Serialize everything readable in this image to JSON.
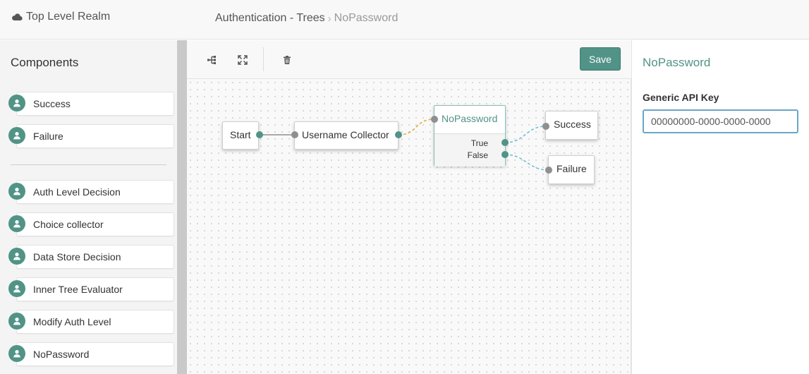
{
  "header": {
    "realm_icon": "cloud-icon",
    "realm": "Top Level Realm",
    "breadcrumb": {
      "parent": "Authentication - Trees",
      "separator": "›",
      "current": "NoPassword"
    }
  },
  "sidebar": {
    "title": "Components",
    "item_icon": "user-icon",
    "top_items": [
      {
        "label": "Success"
      },
      {
        "label": "Failure"
      }
    ],
    "items": [
      {
        "label": "Auth Level Decision"
      },
      {
        "label": "Choice collector"
      },
      {
        "label": "Data Store Decision"
      },
      {
        "label": "Inner Tree Evaluator"
      },
      {
        "label": "Modify Auth Level"
      },
      {
        "label": "NoPassword"
      }
    ]
  },
  "toolbar": {
    "tools": [
      "tree-layout-icon",
      "fullscreen-icon",
      "trash-icon"
    ],
    "save_label": "Save"
  },
  "canvas": {
    "nodes": {
      "start": "Start",
      "username": "Username Collector",
      "nopassword": {
        "title": "NoPassword",
        "outcomes": [
          "True",
          "False"
        ]
      },
      "success": "Success",
      "failure": "Failure"
    }
  },
  "properties": {
    "title": "NoPassword",
    "field_label": "Generic API Key",
    "field_value": "00000000-0000-0000-0000"
  },
  "colors": {
    "accent": "#519387",
    "input_focus": "#6aa6c8",
    "wire_pending": "#e0a73c",
    "wire_outcome": "#67bfd0"
  }
}
